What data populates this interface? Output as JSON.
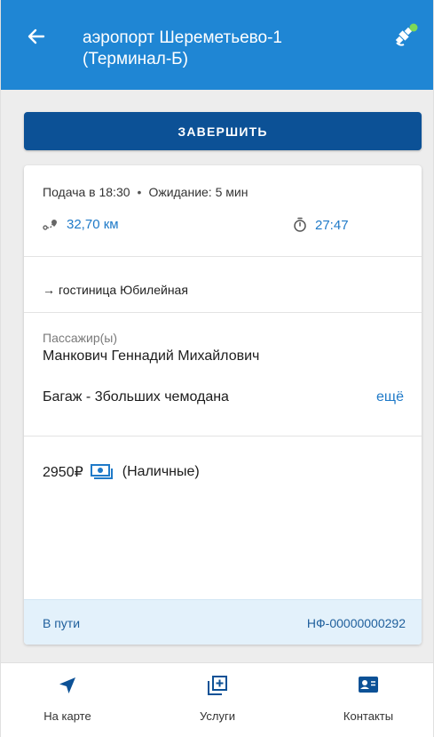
{
  "header": {
    "title": "аэропорт Шереметьево-1\n(Терминал-Б)",
    "back_icon": "arrow-left-icon",
    "gps_icon": "satellite-icon"
  },
  "actions": {
    "finish_label": "ЗАВЕРШИТЬ"
  },
  "order": {
    "pickup": "Подача в 18:30",
    "waiting": "Ожидание: 5 мин",
    "distance": "32,70 км",
    "duration": "27:47",
    "destination": "гостиница Юбилейная",
    "passengers_label": "Пассажир(ы)",
    "passenger_name": "Манкович Геннадий Михайлович",
    "baggage": "Багаж - 3больших чемодана",
    "more_label": "ещё",
    "price": "2950₽",
    "payment_method": "(Наличные)",
    "status": "В пути",
    "number": "НФ-00000000292"
  },
  "nav": [
    {
      "label": "На карте",
      "icon": "navigation-arrow-icon"
    },
    {
      "label": "Услуги",
      "icon": "add-box-icon"
    },
    {
      "label": "Контакты",
      "icon": "contacts-icon"
    }
  ],
  "colors": {
    "app_bar": "#1f86d4",
    "primary_button": "#0c5196",
    "accent": "#1f7ac8",
    "status_bar": "#e3f1fb",
    "gps_dot": "#7ed957"
  }
}
